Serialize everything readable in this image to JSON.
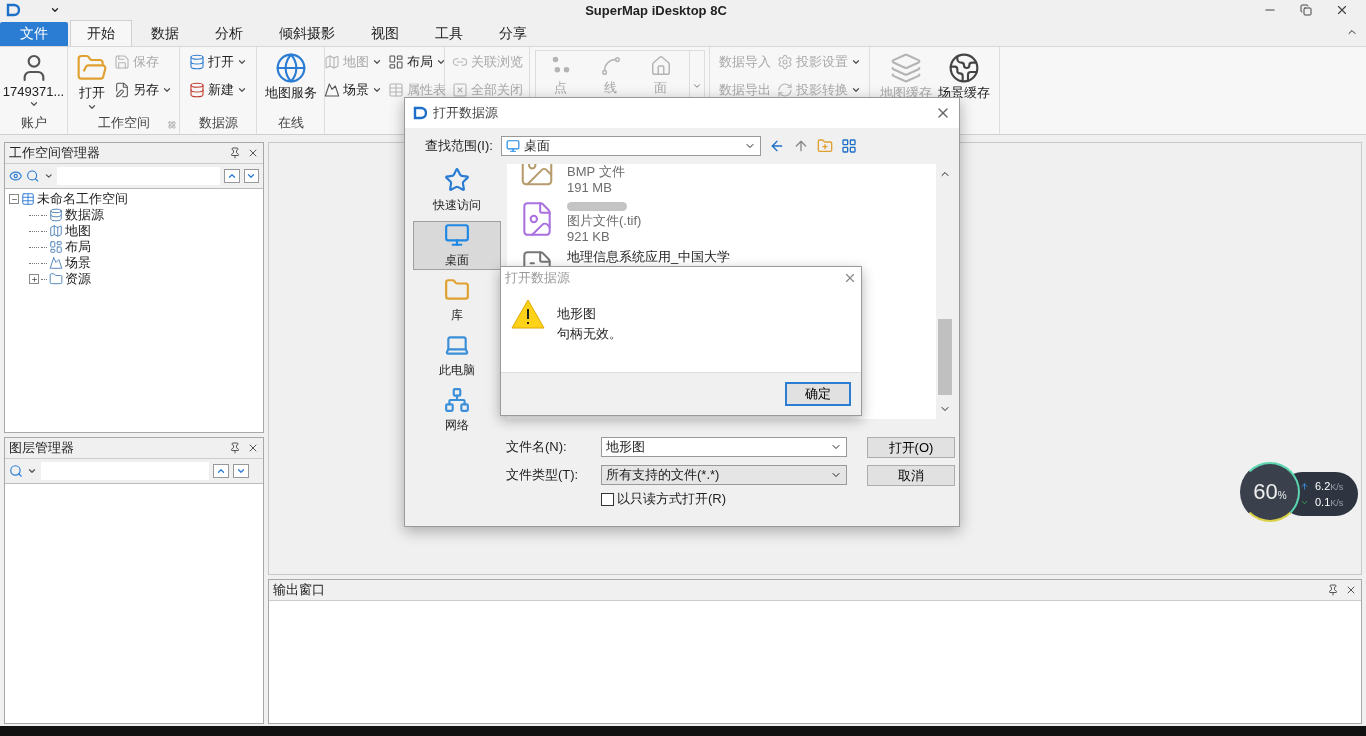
{
  "window": {
    "title": "SuperMap iDesktop 8C"
  },
  "ribbon": {
    "file_tab": "文件",
    "tabs": [
      {
        "label": "开始",
        "selected": true
      },
      {
        "label": "数据",
        "selected": false
      },
      {
        "label": "分析",
        "selected": false
      },
      {
        "label": "倾斜摄影",
        "selected": false
      },
      {
        "label": "视图",
        "selected": false
      },
      {
        "label": "工具",
        "selected": false
      },
      {
        "label": "分享",
        "selected": false
      }
    ],
    "groups": [
      {
        "kind": "buttons",
        "label": "账户",
        "columns": [
          [
            {
              "kind": "large",
              "label": "1749371...",
              "disabled": false,
              "dropdown": true
            }
          ]
        ]
      },
      {
        "kind": "buttons",
        "label": "工作空间",
        "launcher": true,
        "columns": [
          [
            {
              "kind": "large",
              "label": "打开",
              "disabled": false,
              "dropdown": true
            }
          ],
          [
            {
              "kind": "small",
              "label": "保存",
              "disabled": true,
              "dropdown": false
            },
            {
              "kind": "small",
              "label": "另存",
              "disabled": false,
              "dropdown": true
            }
          ]
        ]
      },
      {
        "kind": "buttons",
        "label": "数据源",
        "columns": [
          [
            {
              "kind": "small",
              "label": "打开",
              "disabled": false,
              "dropdown": true
            },
            {
              "kind": "small",
              "label": "新建",
              "disabled": false,
              "dropdown": true
            }
          ]
        ]
      },
      {
        "kind": "buttons",
        "label": "在线",
        "columns": [
          [
            {
              "kind": "large",
              "label": "地图服务",
              "disabled": false,
              "dropdown": false
            }
          ]
        ]
      },
      {
        "kind": "buttons",
        "columns": [
          [
            {
              "kind": "small",
              "label": "地图",
              "disabled": true,
              "dropdown": true
            },
            {
              "kind": "small",
              "label": "场景",
              "disabled": false,
              "dropdown": true
            }
          ],
          [
            {
              "kind": "small",
              "label": "布局",
              "disabled": false,
              "dropdown": true
            },
            {
              "kind": "small",
              "label": "属性表",
              "disabled": true,
              "dropdown": false
            }
          ]
        ]
      },
      {
        "kind": "buttons",
        "columns": [
          [
            {
              "kind": "small",
              "label": "关联浏览",
              "disabled": true,
              "dropdown": false
            },
            {
              "kind": "small",
              "label": "全部关闭",
              "disabled": true,
              "dropdown": false
            }
          ]
        ]
      },
      {
        "kind": "gallery",
        "columns": [
          [
            {
              "kind": "gallery",
              "label": "点",
              "disabled": true
            },
            {
              "kind": "gallery",
              "label": "线",
              "disabled": true
            },
            {
              "kind": "gallery",
              "label": "面",
              "disabled": true
            }
          ]
        ]
      },
      {
        "kind": "buttons",
        "columns": [
          [
            {
              "kind": "small",
              "label": "数据导入",
              "disabled": true,
              "dropdown": false
            },
            {
              "kind": "small",
              "label": "数据导出",
              "disabled": true,
              "dropdown": false
            }
          ],
          [
            {
              "kind": "small",
              "label": "投影设置",
              "disabled": true,
              "dropdown": true
            },
            {
              "kind": "small",
              "label": "投影转换",
              "disabled": true,
              "dropdown": true
            }
          ]
        ]
      },
      {
        "kind": "buttons",
        "columns": [
          [
            {
              "kind": "large",
              "label": "地图缓存",
              "disabled": true,
              "dropdown": false
            }
          ],
          [
            {
              "kind": "large",
              "label": "场景缓存",
              "disabled": false,
              "dropdown": false
            }
          ]
        ]
      }
    ]
  },
  "left_panels": [
    {
      "title": "工作空间管理器",
      "tree": {
        "label": "未命名工作空间",
        "expanded": true,
        "children": [
          {
            "label": "数据源"
          },
          {
            "label": "地图"
          },
          {
            "label": "布局"
          },
          {
            "label": "场景"
          },
          {
            "label": "资源",
            "expanded": false
          }
        ]
      }
    },
    {
      "title": "图层管理器"
    }
  ],
  "output_window": {
    "title": "输出窗口"
  },
  "open_dialog": {
    "title": "打开数据源",
    "look_in_label": "查找范围(I):",
    "look_in_value": "桌面",
    "places": [
      {
        "label": "快速访问",
        "selected": false
      },
      {
        "label": "桌面",
        "selected": true
      },
      {
        "label": "库",
        "selected": false
      },
      {
        "label": "此电脑",
        "selected": false
      },
      {
        "label": "网络",
        "selected": false
      }
    ],
    "files": [
      {
        "kind": "image",
        "type": "BMP 文件",
        "size": "191 MB"
      },
      {
        "kind": "tif",
        "redacted": true,
        "type": "图片文件(.tif)",
        "size": "921 KB"
      },
      {
        "kind": "document",
        "name": "地理信息系统应用_中国大学"
      }
    ],
    "file_name_label": "文件名(N):",
    "file_name": "地形图",
    "file_type_label": "文件类型(T):",
    "file_type": "所有支持的文件(*.*)",
    "readonly": {
      "label": "以只读方式打开(R)",
      "checked": false
    },
    "buttons": [
      "打开(O)",
      "取消"
    ]
  },
  "message_box": {
    "title": "打开数据源",
    "lines": [
      "地形图",
      "句柄无效。"
    ],
    "button": "确定"
  },
  "net_monitor": {
    "percent": "60",
    "percent_unit": "%",
    "upload": "6.2",
    "upload_unit": "K/s",
    "download": "0.1",
    "download_unit": "K/s"
  }
}
